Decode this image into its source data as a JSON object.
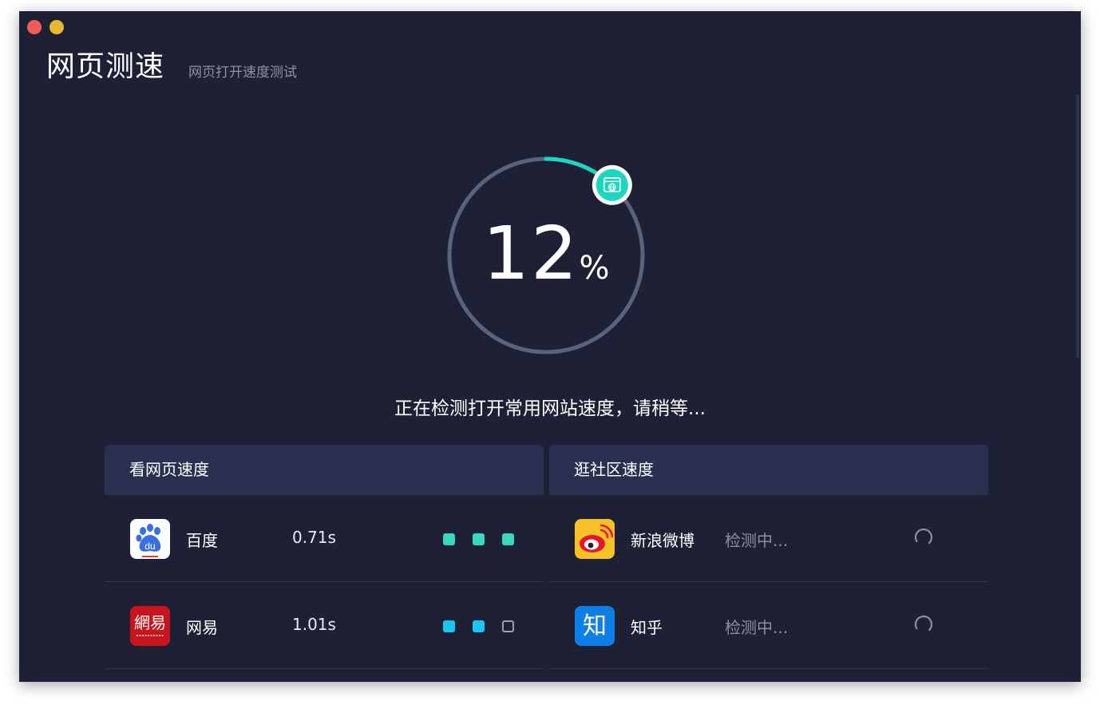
{
  "window": {
    "title": "网页测速",
    "subtitle": "网页打开速度测试"
  },
  "progress": {
    "value": "12",
    "unit": "%",
    "fraction": 0.12,
    "track_color": "#59647c",
    "fill_color": "#1dd6bf",
    "status_text": "正在检测打开常用网站速度，请稍等..."
  },
  "panels": {
    "browse": {
      "title": "看网页速度",
      "rows": [
        {
          "name": "百度",
          "time": "0.71s",
          "dots": [
            "filled",
            "filled",
            "filled"
          ],
          "dot_color": "#37d8bb",
          "icon": "baidu-icon"
        },
        {
          "name": "网易",
          "time": "1.01s",
          "dots": [
            "filled",
            "filled",
            "empty"
          ],
          "dot_color": "#18c6f2",
          "icon": "netease-icon"
        }
      ]
    },
    "community": {
      "title": "逛社区速度",
      "rows": [
        {
          "name": "新浪微博",
          "status": "检测中...",
          "icon": "weibo-icon"
        },
        {
          "name": "知乎",
          "status": "检测中...",
          "icon": "zhihu-icon"
        }
      ]
    }
  },
  "icons": {
    "baidu_text": "du",
    "netease_text": "網易",
    "zhihu_text": "知"
  }
}
